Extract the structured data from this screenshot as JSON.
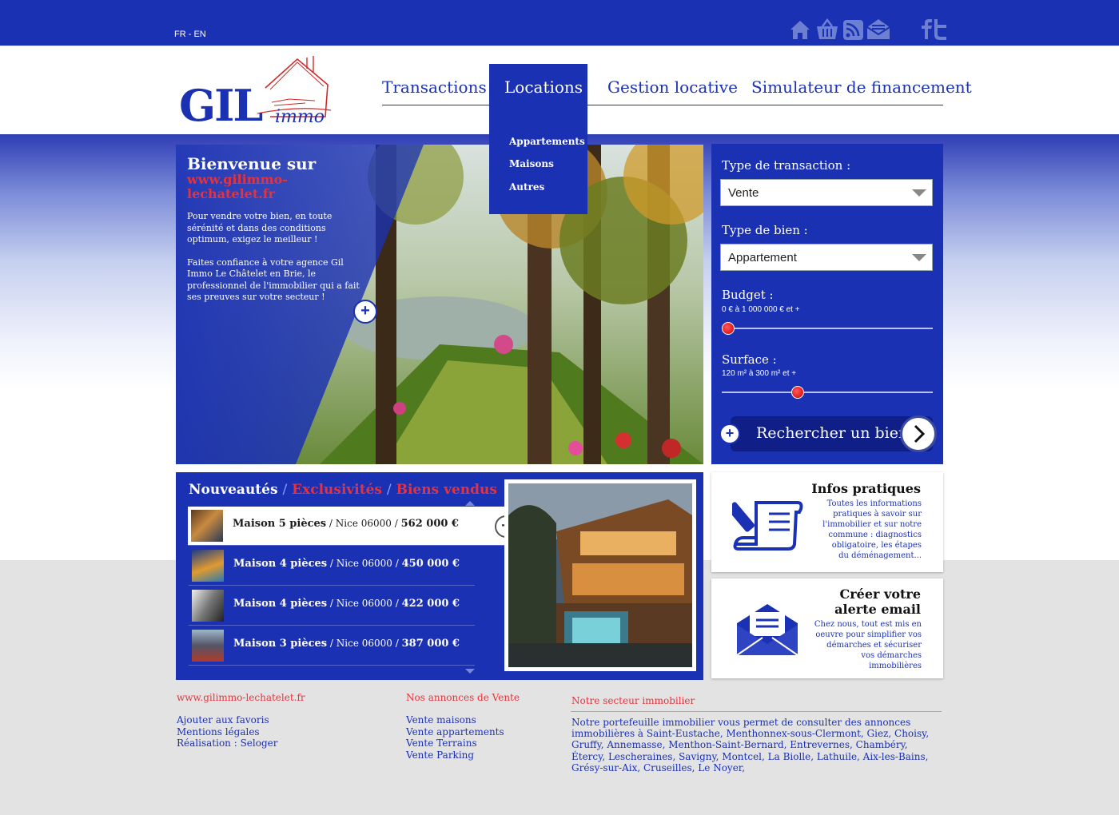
{
  "header": {
    "languages": "FR - EN",
    "logo": {
      "main": "GIL",
      "sub": "immo"
    },
    "top_icons": [
      "home-icon",
      "basket-icon",
      "rss-icon",
      "mail-icon",
      "facebook-icon",
      "twitter-icon"
    ],
    "nav": [
      {
        "label": "Transactions"
      },
      {
        "label": "Locations",
        "active": true
      },
      {
        "label": "Gestion locative"
      },
      {
        "label": "Simulateur de financement"
      }
    ],
    "dropdown": [
      "Appartements",
      "Maisons",
      "Autres"
    ]
  },
  "hero": {
    "title": "Bienvenue sur",
    "url": "www.gilimmo-lechatelet.fr",
    "para1": "Pour vendre votre bien, en toute sérénité et dans des conditions optimum, exigez le meilleur !",
    "para2": "Faites confiance à votre agence Gil Immo Le Châtelet en Brie, le professionnel de l'immobilier qui a fait ses preuves sur votre secteur !",
    "plus": "+"
  },
  "search": {
    "transaction_label": "Type de transaction :",
    "transaction_value": "Vente",
    "bien_label": "Type de bien :",
    "bien_value": "Appartement",
    "budget_label": "Budget :",
    "budget_range": "0 € à 1 000 000 € et +",
    "budget_fraction": 0.0,
    "surface_label": "Surface :",
    "surface_range": "120 m² à 300 m² et +",
    "surface_fraction": 0.35,
    "button": "Rechercher un bien",
    "plus": "+"
  },
  "listings": {
    "tab_new": "Nouveautés",
    "sep": "/",
    "tab_exclusive": "Exclusivités",
    "tab_sold": "Biens vendus",
    "plus": "+",
    "items": [
      {
        "type": "Maison 5 pièces",
        "detail": " / Nice 06000 / ",
        "price": "562 000 €"
      },
      {
        "type": "Maison 4 pièces",
        "detail": " / Nice 06000 / ",
        "price": "450 000 €"
      },
      {
        "type": "Maison 4 pièces",
        "detail": " / Nice 06000 / ",
        "price": "422 000 €"
      },
      {
        "type": "Maison 3 pièces",
        "detail": " / Nice 06000 / ",
        "price": "387 000 €"
      }
    ]
  },
  "infos": {
    "title": "Infos pratiques",
    "text": "Toutes les informations pratiques à savoir sur l'immobilier et sur notre commune : diagnostics obligatoire, les étapes du déménagement..."
  },
  "alert": {
    "title1": "Créer votre",
    "title2": "alerte email",
    "text": "Chez nous, tout est mis en oeuvre pour simplifier vos démarches et sécuriser vos démarches immobilières"
  },
  "footer": {
    "col1": {
      "title": "www.gilimmo-lechatelet.fr",
      "links": [
        "Ajouter aux favoris",
        "Mentions légales",
        "Réalisation : Seloger"
      ]
    },
    "col2": {
      "title": "Nos annonces de Vente",
      "links": [
        "Vente maisons",
        "Vente appartements",
        "Vente Terrains",
        "Vente Parking"
      ]
    },
    "col3": {
      "title": "Notre secteur immobilier",
      "text": "Notre portefeuille immobilier vous permet de consulter des annonces immobilières à Saint-Eustache, Menthonnex-sous-Clermont, Giez, Choisy, Gruffy, Annemasse, Menthon-Saint-Bernard, Entrevernes, Chambéry, Étercy, Lescheraines, Savigny, Montcel, La Biolle, Lathuile, Aix-les-Bains, Grésy-sur-Aix, Cruseilles, Le Noyer,"
    }
  },
  "colors": {
    "brand": "#1b31b4",
    "accent": "#e8323b"
  }
}
